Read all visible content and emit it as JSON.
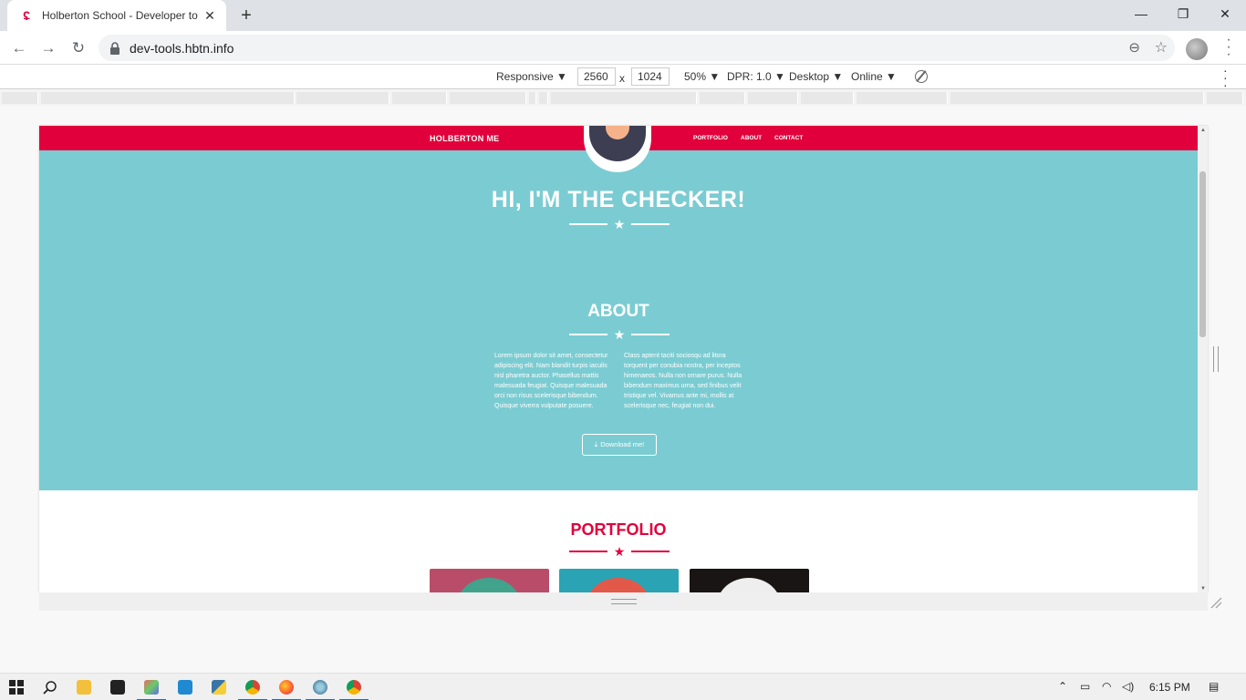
{
  "browser": {
    "tab_title": "Holberton School - Developer to",
    "url": "dev-tools.hbtn.info",
    "new_tab": "+",
    "close_tab": "✕",
    "window_controls": {
      "minimize": "—",
      "maximize": "❐",
      "close": "✕"
    }
  },
  "devtools": {
    "device": "Responsive ▼",
    "width": "2560",
    "times": "x",
    "height": "1024",
    "zoom": "50% ▼",
    "dpr": "DPR: 1.0 ▼",
    "mode": "Desktop ▼",
    "network": "Online ▼"
  },
  "site": {
    "brand": "HOLBERTON ME",
    "nav": [
      "PORTFOLIO",
      "ABOUT",
      "CONTACT"
    ],
    "hero_title": "HI, I'M THE CHECKER!",
    "about_title": "ABOUT",
    "about_col1": "Lorem ipsum dolor sit amet, consectetur adipiscing elit. Nam blandit turpis iaculis nisl pharetra auctor. Phasellus mattis malesuada feugiat. Quisque malesuada orci non risus scelerisque bibendum. Quisque viverra vulputate posuere.",
    "about_col2": "Class aptent taciti sociosqu ad litora torquent per conubia nostra, per inceptos himenaeos. Nulla non ornare purus. Nulla bibendum maximus urna, sed finibus velit tristique vel. Vivamus ante mi, mollis at scelerisque nec, feugiat non dui.",
    "download_label": "Download me!",
    "portfolio_title": "PORTFOLIO",
    "colors": {
      "brand_red": "#e2003c",
      "hero_teal": "#7accd2"
    }
  },
  "taskbar": {
    "time": "6:15 PM"
  }
}
